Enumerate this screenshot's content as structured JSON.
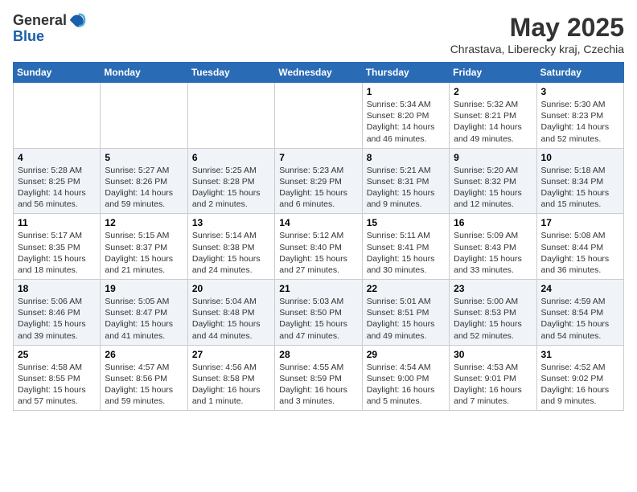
{
  "header": {
    "logo_general": "General",
    "logo_blue": "Blue",
    "month_year": "May 2025",
    "location": "Chrastava, Liberecky kraj, Czechia"
  },
  "weekdays": [
    "Sunday",
    "Monday",
    "Tuesday",
    "Wednesday",
    "Thursday",
    "Friday",
    "Saturday"
  ],
  "weeks": [
    [
      {
        "day": "",
        "info": ""
      },
      {
        "day": "",
        "info": ""
      },
      {
        "day": "",
        "info": ""
      },
      {
        "day": "",
        "info": ""
      },
      {
        "day": "1",
        "info": "Sunrise: 5:34 AM\nSunset: 8:20 PM\nDaylight: 14 hours\nand 46 minutes."
      },
      {
        "day": "2",
        "info": "Sunrise: 5:32 AM\nSunset: 8:21 PM\nDaylight: 14 hours\nand 49 minutes."
      },
      {
        "day": "3",
        "info": "Sunrise: 5:30 AM\nSunset: 8:23 PM\nDaylight: 14 hours\nand 52 minutes."
      }
    ],
    [
      {
        "day": "4",
        "info": "Sunrise: 5:28 AM\nSunset: 8:25 PM\nDaylight: 14 hours\nand 56 minutes."
      },
      {
        "day": "5",
        "info": "Sunrise: 5:27 AM\nSunset: 8:26 PM\nDaylight: 14 hours\nand 59 minutes."
      },
      {
        "day": "6",
        "info": "Sunrise: 5:25 AM\nSunset: 8:28 PM\nDaylight: 15 hours\nand 2 minutes."
      },
      {
        "day": "7",
        "info": "Sunrise: 5:23 AM\nSunset: 8:29 PM\nDaylight: 15 hours\nand 6 minutes."
      },
      {
        "day": "8",
        "info": "Sunrise: 5:21 AM\nSunset: 8:31 PM\nDaylight: 15 hours\nand 9 minutes."
      },
      {
        "day": "9",
        "info": "Sunrise: 5:20 AM\nSunset: 8:32 PM\nDaylight: 15 hours\nand 12 minutes."
      },
      {
        "day": "10",
        "info": "Sunrise: 5:18 AM\nSunset: 8:34 PM\nDaylight: 15 hours\nand 15 minutes."
      }
    ],
    [
      {
        "day": "11",
        "info": "Sunrise: 5:17 AM\nSunset: 8:35 PM\nDaylight: 15 hours\nand 18 minutes."
      },
      {
        "day": "12",
        "info": "Sunrise: 5:15 AM\nSunset: 8:37 PM\nDaylight: 15 hours\nand 21 minutes."
      },
      {
        "day": "13",
        "info": "Sunrise: 5:14 AM\nSunset: 8:38 PM\nDaylight: 15 hours\nand 24 minutes."
      },
      {
        "day": "14",
        "info": "Sunrise: 5:12 AM\nSunset: 8:40 PM\nDaylight: 15 hours\nand 27 minutes."
      },
      {
        "day": "15",
        "info": "Sunrise: 5:11 AM\nSunset: 8:41 PM\nDaylight: 15 hours\nand 30 minutes."
      },
      {
        "day": "16",
        "info": "Sunrise: 5:09 AM\nSunset: 8:43 PM\nDaylight: 15 hours\nand 33 minutes."
      },
      {
        "day": "17",
        "info": "Sunrise: 5:08 AM\nSunset: 8:44 PM\nDaylight: 15 hours\nand 36 minutes."
      }
    ],
    [
      {
        "day": "18",
        "info": "Sunrise: 5:06 AM\nSunset: 8:46 PM\nDaylight: 15 hours\nand 39 minutes."
      },
      {
        "day": "19",
        "info": "Sunrise: 5:05 AM\nSunset: 8:47 PM\nDaylight: 15 hours\nand 41 minutes."
      },
      {
        "day": "20",
        "info": "Sunrise: 5:04 AM\nSunset: 8:48 PM\nDaylight: 15 hours\nand 44 minutes."
      },
      {
        "day": "21",
        "info": "Sunrise: 5:03 AM\nSunset: 8:50 PM\nDaylight: 15 hours\nand 47 minutes."
      },
      {
        "day": "22",
        "info": "Sunrise: 5:01 AM\nSunset: 8:51 PM\nDaylight: 15 hours\nand 49 minutes."
      },
      {
        "day": "23",
        "info": "Sunrise: 5:00 AM\nSunset: 8:53 PM\nDaylight: 15 hours\nand 52 minutes."
      },
      {
        "day": "24",
        "info": "Sunrise: 4:59 AM\nSunset: 8:54 PM\nDaylight: 15 hours\nand 54 minutes."
      }
    ],
    [
      {
        "day": "25",
        "info": "Sunrise: 4:58 AM\nSunset: 8:55 PM\nDaylight: 15 hours\nand 57 minutes."
      },
      {
        "day": "26",
        "info": "Sunrise: 4:57 AM\nSunset: 8:56 PM\nDaylight: 15 hours\nand 59 minutes."
      },
      {
        "day": "27",
        "info": "Sunrise: 4:56 AM\nSunset: 8:58 PM\nDaylight: 16 hours\nand 1 minute."
      },
      {
        "day": "28",
        "info": "Sunrise: 4:55 AM\nSunset: 8:59 PM\nDaylight: 16 hours\nand 3 minutes."
      },
      {
        "day": "29",
        "info": "Sunrise: 4:54 AM\nSunset: 9:00 PM\nDaylight: 16 hours\nand 5 minutes."
      },
      {
        "day": "30",
        "info": "Sunrise: 4:53 AM\nSunset: 9:01 PM\nDaylight: 16 hours\nand 7 minutes."
      },
      {
        "day": "31",
        "info": "Sunrise: 4:52 AM\nSunset: 9:02 PM\nDaylight: 16 hours\nand 9 minutes."
      }
    ]
  ]
}
